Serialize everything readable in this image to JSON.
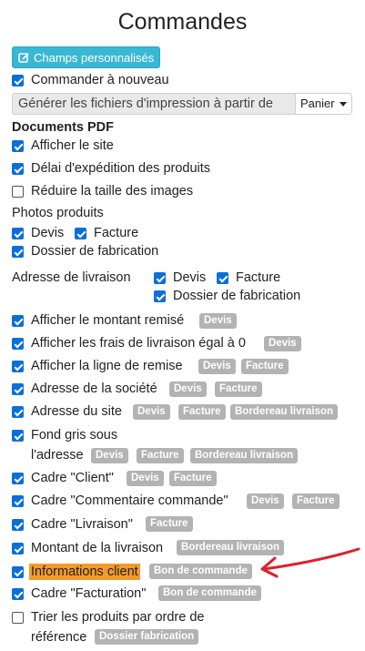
{
  "header": {
    "title": "Commandes"
  },
  "toolbar": {
    "custom_fields_label": "Champs personnalisés"
  },
  "reorder": {
    "label": "Commander à nouveau"
  },
  "generate": {
    "label": "Générer les fichiers d'impression à partir de",
    "selected": "Panier"
  },
  "pdf": {
    "section_title": "Documents PDF",
    "show_site": "Afficher le site",
    "shipping_delay": "Délai d'expédition des produits",
    "reduce_images": "Réduire la taille des images"
  },
  "photos": {
    "label": "Photos produits",
    "quote": "Devis",
    "invoice": "Facture",
    "fabrication": "Dossier de fabrication"
  },
  "delivery_address": {
    "label": "Adresse de livraison",
    "quote": "Devis",
    "invoice": "Facture",
    "fabrication": "Dossier de fabrication"
  },
  "options": [
    {
      "label": "Afficher le montant remisé",
      "badges": [
        "Devis"
      ]
    },
    {
      "label": "Afficher les frais de livraison égal à 0",
      "badges": [
        "Devis"
      ]
    },
    {
      "label": "Afficher la ligne de remise",
      "badges": [
        "Devis",
        "Facture"
      ]
    },
    {
      "label": "Adresse de la société",
      "badges": [
        "Devis",
        "Facture"
      ]
    },
    {
      "label": "Adresse du site",
      "badges": [
        "Devis",
        "Facture",
        "Bordereau livraison"
      ]
    },
    {
      "label_line1": "Fond gris sous",
      "label_line2": "l'adresse",
      "badges": [
        "Devis",
        "Facture",
        "Bordereau livraison"
      ]
    },
    {
      "label": "Cadre \"Client\"",
      "badges": [
        "Devis",
        "Facture"
      ]
    },
    {
      "label": "Cadre \"Commentaire commande\"",
      "badges": [
        "Devis",
        "Facture"
      ]
    },
    {
      "label": "Cadre \"Livraison\"",
      "badges": [
        "Facture"
      ]
    },
    {
      "label": "Montant de la livraison",
      "badges": [
        "Bordereau livraison"
      ]
    },
    {
      "label": "Informations client",
      "badges": [
        "Bon de commande"
      ]
    },
    {
      "label": "Cadre \"Facturation\"",
      "badges": [
        "Bon de commande"
      ]
    },
    {
      "label_line1": "Trier les produits par ordre de",
      "label_line2": "référence",
      "badges": [
        "Dossier fabrication"
      ]
    }
  ],
  "colors": {
    "accent": "#39b8d4",
    "checkbox": "#0b6fd8",
    "badge": "#b3b3b3",
    "highlight": "#f49a2c",
    "arrow": "#e0202a"
  }
}
